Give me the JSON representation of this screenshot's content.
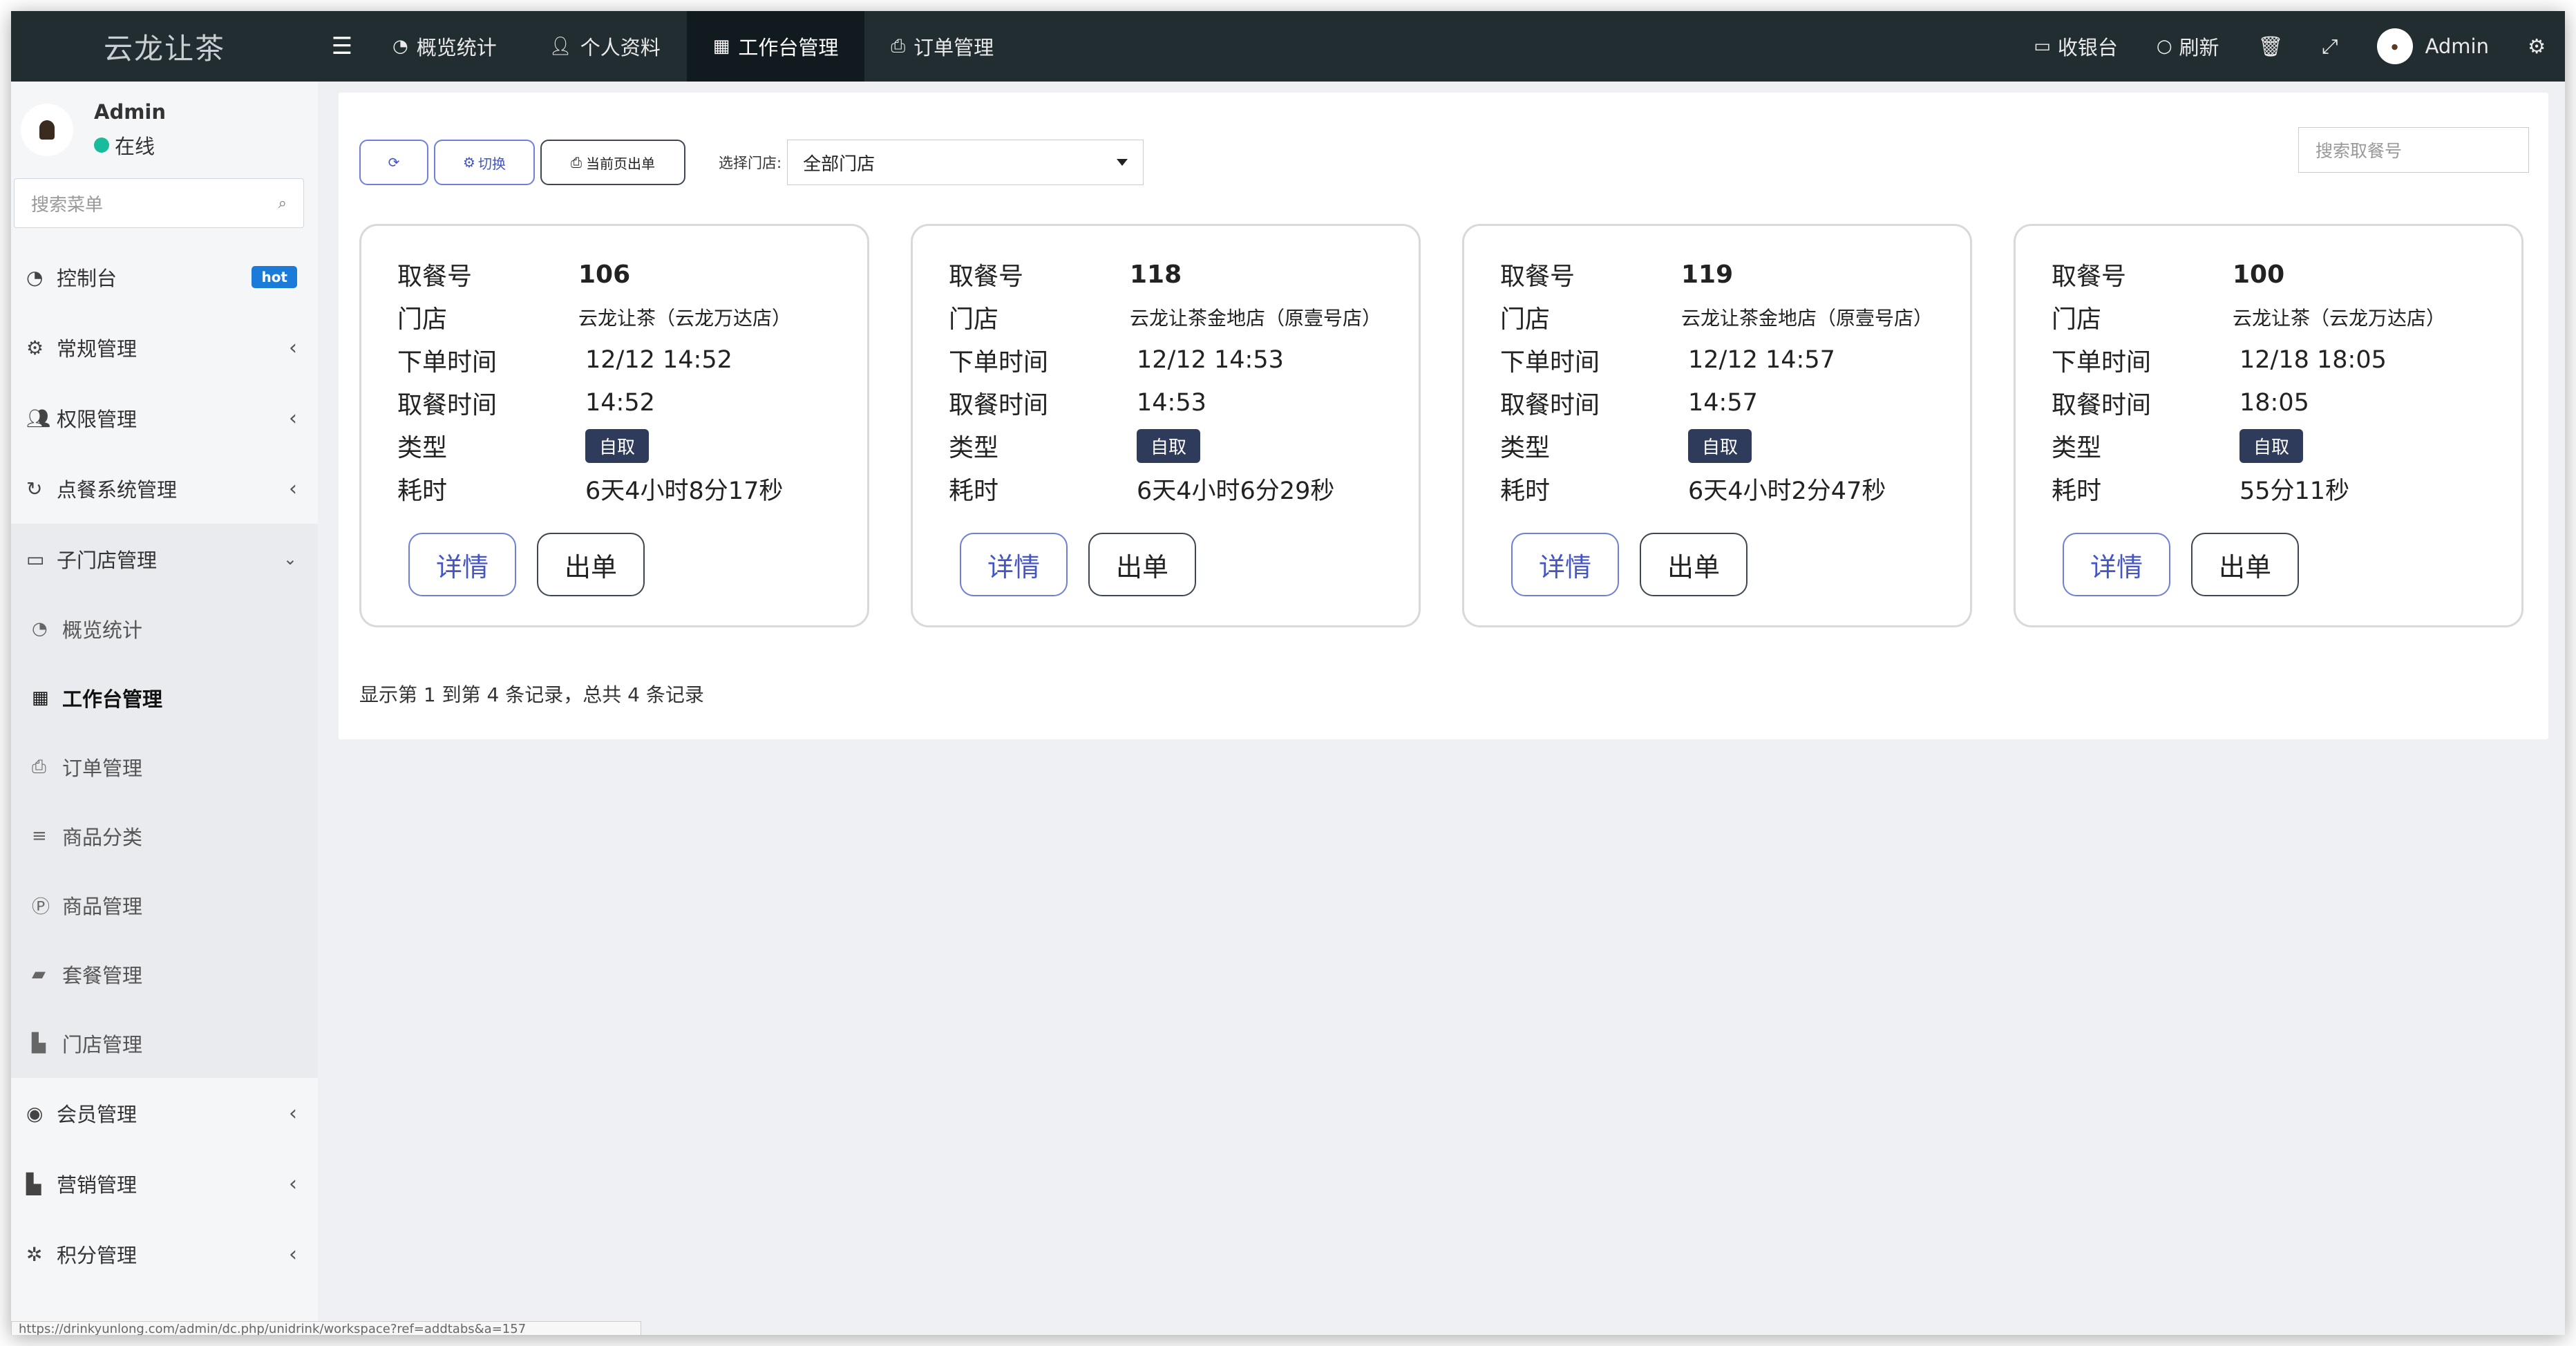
{
  "app": {
    "logo": "云龙让茶"
  },
  "topnav": {
    "items": [
      {
        "label": "概览统计",
        "icon": "dashboard-icon"
      },
      {
        "label": "个人资料",
        "icon": "user-icon"
      },
      {
        "label": "工作台管理",
        "icon": "table-icon",
        "active": true
      },
      {
        "label": "订单管理",
        "icon": "print-icon"
      }
    ],
    "right": {
      "cashier": "收银台",
      "refresh": "刷新",
      "user": "Admin"
    }
  },
  "sidebar": {
    "user_name": "Admin",
    "status": "在线",
    "search_placeholder": "搜索菜单",
    "items": [
      {
        "label": "控制台",
        "badge": "hot"
      },
      {
        "label": "常规管理"
      },
      {
        "label": "权限管理"
      },
      {
        "label": "点餐系统管理"
      },
      {
        "label": "子门店管理"
      }
    ],
    "sub_items": [
      {
        "label": "概览统计"
      },
      {
        "label": "工作台管理",
        "active": true
      },
      {
        "label": "订单管理"
      },
      {
        "label": "商品分类"
      },
      {
        "label": "商品管理"
      },
      {
        "label": "套餐管理"
      },
      {
        "label": "门店管理"
      }
    ],
    "items_after": [
      {
        "label": "会员管理"
      },
      {
        "label": "营销管理"
      },
      {
        "label": "积分管理"
      }
    ],
    "status_url": "https://drinkyunlong.com/admin/dc.php/unidrink/workspace?ref=addtabs&a=157"
  },
  "toolbar": {
    "switch_label": "切换",
    "print_label": "当前页出单",
    "store_label": "选择门店:",
    "store_value": "全部门店",
    "search_placeholder": "搜索取餐号"
  },
  "labels": {
    "number": "取餐号",
    "store": "门店",
    "order_time": "下单时间",
    "pickup_time": "取餐时间",
    "type": "类型",
    "elapsed": "耗时",
    "detail_btn": "详情",
    "out_btn": "出单"
  },
  "orders": [
    {
      "number": "106",
      "store": "云龙让茶（云龙万达店）",
      "order_time": "12/12 14:52",
      "pickup_time": "14:52",
      "type": "自取",
      "elapsed": "6天4小时8分17秒"
    },
    {
      "number": "118",
      "store": "云龙让茶金地店（原壹号店）",
      "order_time": "12/12 14:53",
      "pickup_time": "14:53",
      "type": "自取",
      "elapsed": "6天4小时6分29秒"
    },
    {
      "number": "119",
      "store": "云龙让茶金地店（原壹号店）",
      "order_time": "12/12 14:57",
      "pickup_time": "14:57",
      "type": "自取",
      "elapsed": "6天4小时2分47秒"
    },
    {
      "number": "100",
      "store": "云龙让茶（云龙万达店）",
      "order_time": "12/18 18:05",
      "pickup_time": "18:05",
      "type": "自取",
      "elapsed": "55分11秒"
    }
  ],
  "pager": {
    "text": "显示第 1 到第 4 条记录，总共 4 条记录"
  },
  "colors": {
    "navbar": "#222d32",
    "accent": "#6f7fd9",
    "badge": "#2f3b5a",
    "online": "#18bc9c",
    "hot": "#1a7bd8"
  }
}
